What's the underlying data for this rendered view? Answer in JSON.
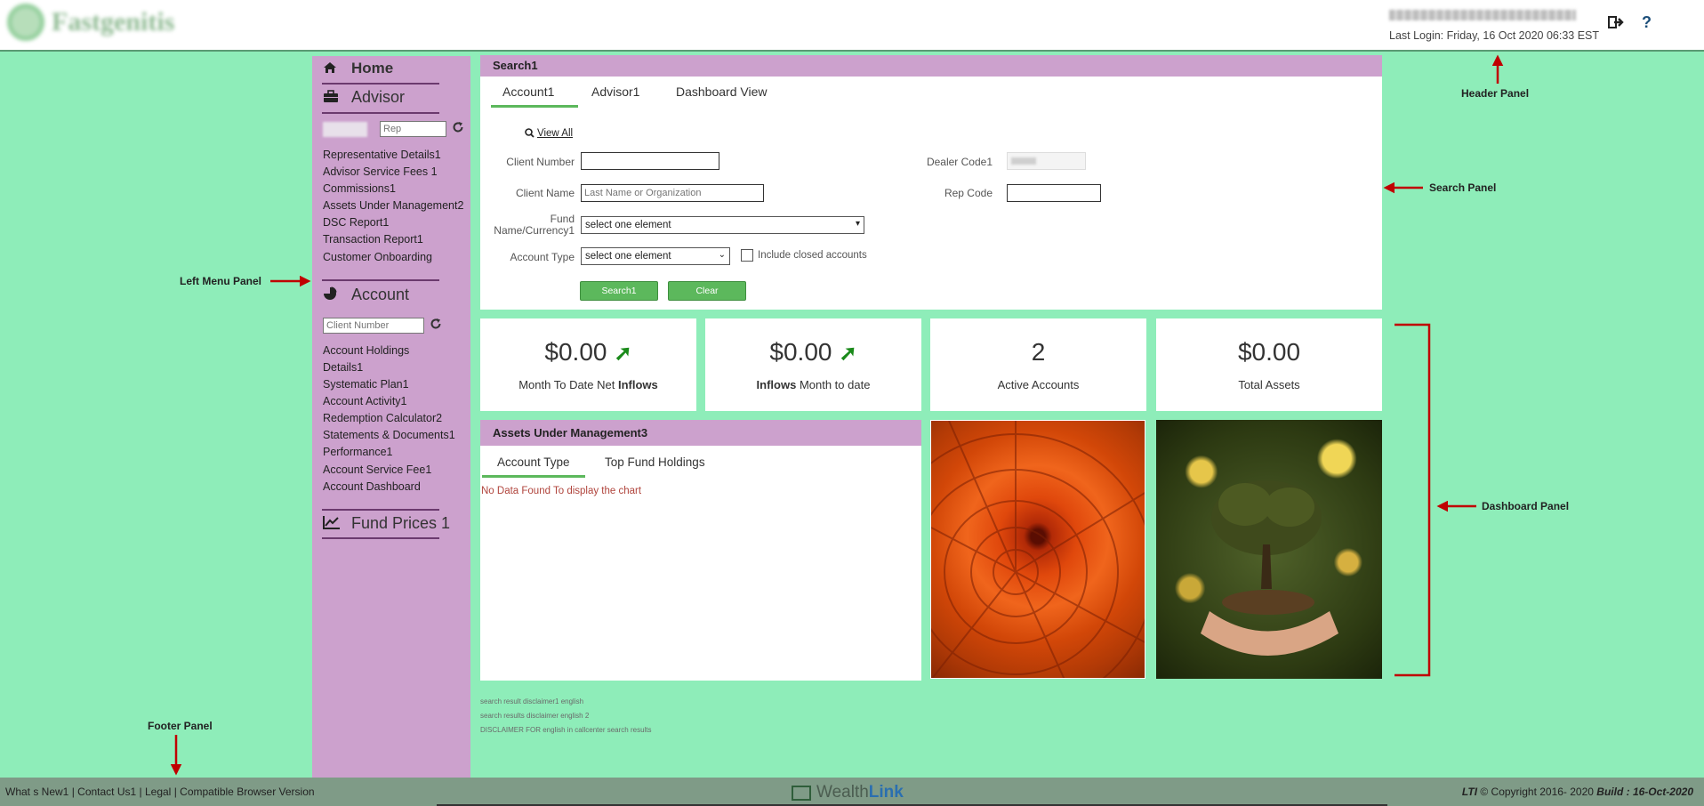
{
  "header": {
    "logo_label": "Fastgenitis",
    "last_login": "Last Login: Friday, 16 Oct 2020 06:33 EST",
    "logout_icon": "logout-icon",
    "help_icon": "help-icon",
    "help_label": "?"
  },
  "left_menu": {
    "home_label": "Home",
    "advisor_label": "Advisor",
    "rep_placeholder": "Rep",
    "advisor_links": [
      "Representative Details1",
      "Advisor Service Fees 1",
      "Commissions1",
      "Assets Under Management2",
      "DSC Report1",
      "Transaction Report1",
      "Customer Onboarding"
    ],
    "account_label": "Account",
    "client_number_placeholder": "Client Number",
    "account_links": [
      "Account Holdings",
      "Details1",
      "Systematic Plan1",
      "Account Activity1",
      "Redemption Calculator2",
      "Statements & Documents1",
      "Performance1",
      "Account Service Fee1",
      "Account Dashboard"
    ],
    "fund_prices_label": "Fund Prices 1"
  },
  "search": {
    "title": "Search1",
    "tabs": [
      "Account1",
      "Advisor1",
      "Dashboard View"
    ],
    "active_tab": "Account1",
    "view_all": "View All",
    "client_number_label": "Client Number",
    "client_number_value": "",
    "client_name_label": "Client Name",
    "client_name_placeholder": "Last Name or Organization",
    "fund_label_line1": "Fund",
    "fund_label_line2": "Name/Currency1",
    "fund_selected": "select one element",
    "account_type_label": "Account Type",
    "account_type_selected": "select one element",
    "include_closed_label": "Include closed accounts",
    "include_closed_checked": false,
    "dealer_code_label": "Dealer Code1",
    "rep_code_label": "Rep Code",
    "rep_code_value": "",
    "search_button": "Search1",
    "clear_button": "Clear"
  },
  "stats": [
    {
      "value": "$0.00",
      "caption_pre": "Month To Date Net ",
      "caption_bold": "Inflows",
      "caption_post": "",
      "trend": "up"
    },
    {
      "value": "$0.00",
      "caption_pre": "",
      "caption_bold": "Inflows",
      "caption_post": " Month to date",
      "trend": "up"
    },
    {
      "value": "2",
      "caption_pre": "Active Accounts",
      "caption_bold": "",
      "caption_post": ""
    },
    {
      "value": "$0.00",
      "caption_pre": "Total Assets",
      "caption_bold": "",
      "caption_post": ""
    }
  ],
  "aum": {
    "title": "Assets Under Management3",
    "tabs": [
      "Account Type",
      "Top Fund Holdings"
    ],
    "active_tab": "Account Type",
    "no_data": "No Data Found To display the chart"
  },
  "disclaimers": [
    "search result disclaimer1 english",
    "search results disclaimer english 2",
    "DISCLAIMER FOR english in callcenter search results"
  ],
  "annotations": {
    "header_panel": "Header Panel",
    "search_panel": "Search Panel",
    "left_menu_panel": "Left Menu Panel",
    "dashboard_panel": "Dashboard Panel",
    "footer_panel": "Footer Panel"
  },
  "footer": {
    "links": [
      "What s New1",
      "Contact Us1",
      "Legal",
      "Compatible Browser Version"
    ],
    "separator": " | ",
    "logo_part1": "Wealth",
    "logo_part2": "Link",
    "copyright_company": "LTI",
    "copyright_text": " © Copyright 2016- 2020 ",
    "build_label": "Build : 16-Oct-2020"
  },
  "colors": {
    "page_bg": "#8eedb9",
    "panel_header": "#cca1cd",
    "accent_green": "#5cb85c",
    "annotation_red": "#c00000",
    "footer_bg": "#7f9b87"
  }
}
